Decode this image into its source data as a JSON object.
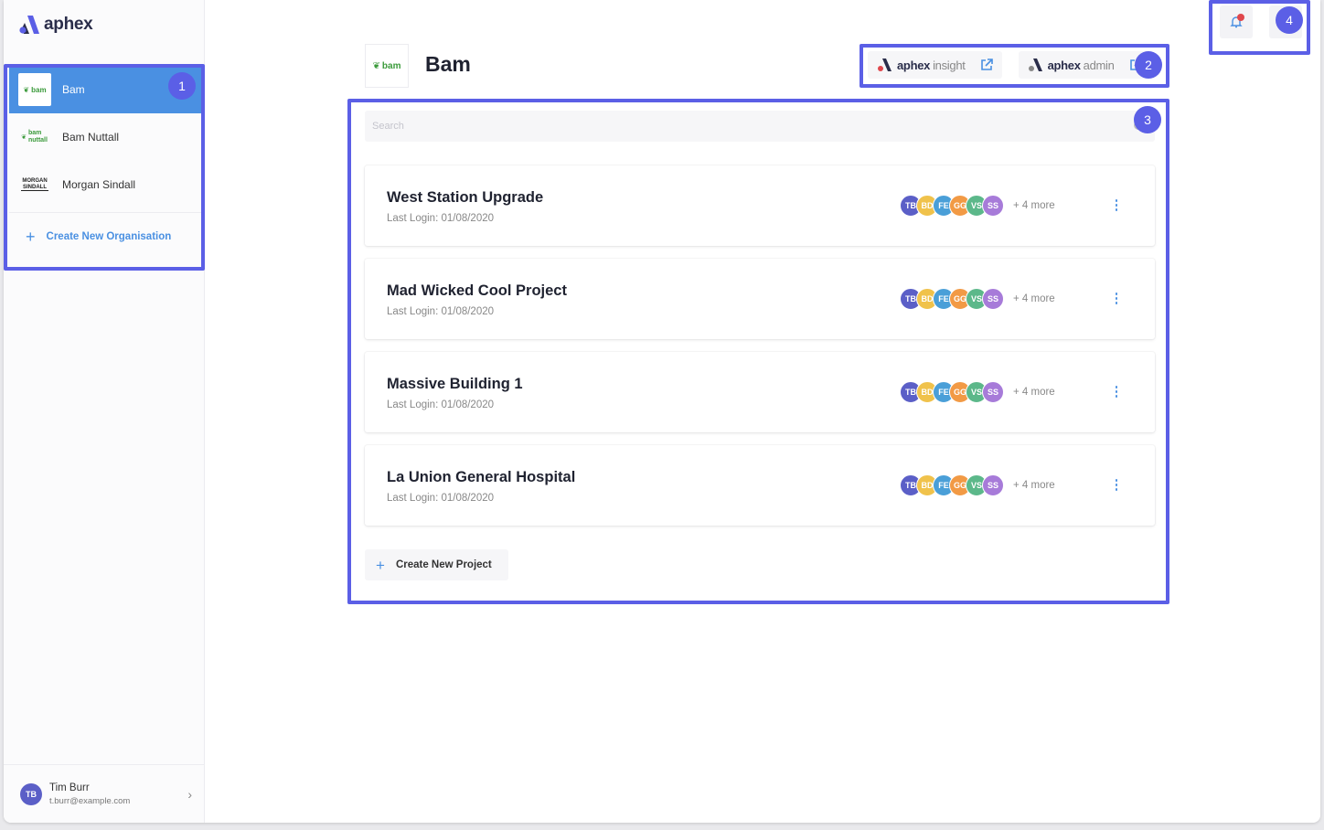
{
  "brand": {
    "name": "aphex"
  },
  "sidebar": {
    "orgs": [
      {
        "label": "Bam",
        "logo": "bam",
        "active": true
      },
      {
        "label": "Bam Nuttall",
        "logo": "bam nuttall",
        "active": false
      },
      {
        "label": "Morgan Sindall",
        "logo": "MORGAN SINDALL",
        "active": false
      }
    ],
    "create_org_label": "Create New Organisation",
    "user": {
      "initials": "TB",
      "name": "Tim Burr",
      "email": "t.burr@example.com"
    }
  },
  "header": {
    "org_logo": "bam",
    "org_title": "Bam",
    "apps": [
      {
        "strong": "aphex",
        "light": "insight"
      },
      {
        "strong": "aphex",
        "light": "admin"
      }
    ]
  },
  "search": {
    "placeholder": "Search",
    "value": ""
  },
  "projects": [
    {
      "name": "West Station Upgrade",
      "last_login": "Last Login: 01/08/2020",
      "more": "+ 4 more"
    },
    {
      "name": "Mad Wicked Cool Project",
      "last_login": "Last Login: 01/08/2020",
      "more": "+ 4 more"
    },
    {
      "name": "Massive Building 1",
      "last_login": "Last Login: 01/08/2020",
      "more": "+ 4 more"
    },
    {
      "name": "La Union General Hospital",
      "last_login": "Last Login: 01/08/2020",
      "more": "+ 4 more"
    }
  ],
  "team_members": [
    {
      "initials": "TB",
      "color": "#5b5fc7"
    },
    {
      "initials": "BD",
      "color": "#f0c24b"
    },
    {
      "initials": "FE",
      "color": "#4a9fd8"
    },
    {
      "initials": "GG",
      "color": "#f29a45"
    },
    {
      "initials": "VS",
      "color": "#5cb88a"
    },
    {
      "initials": "SS",
      "color": "#a77bd9"
    }
  ],
  "create_project_label": "Create New Project",
  "annotations": [
    {
      "label": "1"
    },
    {
      "label": "2"
    },
    {
      "label": "3"
    },
    {
      "label": "4"
    }
  ],
  "colors": {
    "accent": "#4a90e2",
    "annotation": "#5b5fe6",
    "notification": "#e0474c"
  }
}
